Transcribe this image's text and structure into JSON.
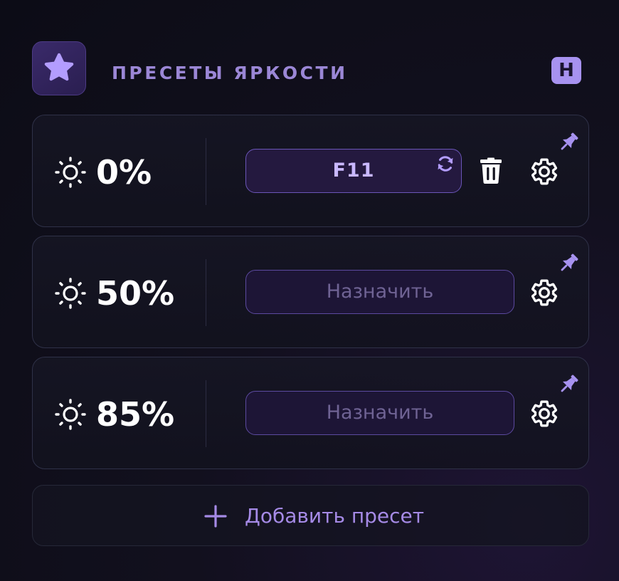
{
  "header": {
    "title": "ПРЕСЕТЫ ЯРКОСТИ",
    "icon": "star-icon",
    "badge": "H"
  },
  "presets": [
    {
      "value": "0%",
      "key_label": "F11",
      "assigned": true,
      "icons": [
        "sun-icon",
        "refresh-icon",
        "trash-icon",
        "gear-icon",
        "pin-icon"
      ]
    },
    {
      "value": "50%",
      "key_label": "Назначить",
      "assigned": false,
      "icons": [
        "sun-icon",
        "gear-icon",
        "pin-icon"
      ]
    },
    {
      "value": "85%",
      "key_label": "Назначить",
      "assigned": false,
      "icons": [
        "sun-icon",
        "gear-icon",
        "pin-icon"
      ]
    }
  ],
  "add_button": {
    "label": "Добавить пресет",
    "icon": "plus-icon"
  },
  "colors": {
    "accent": "#a792f0",
    "title": "#9b87d6",
    "background": "#0c0c16",
    "card_border": "#2f3148"
  }
}
